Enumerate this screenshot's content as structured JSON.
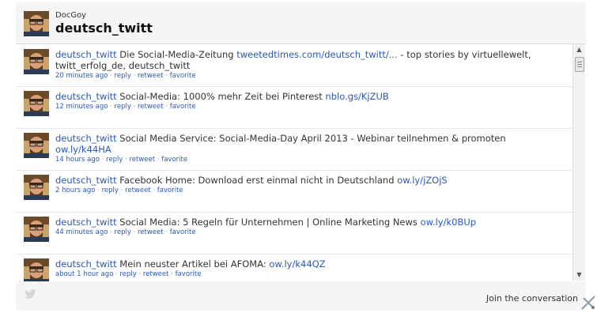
{
  "header": {
    "subline": "DocGoy",
    "title": "deutsch_twitt",
    "avatar_icon": "profile-avatar"
  },
  "tweets": [
    {
      "user": "deutsch_twitt",
      "text": " Die Social-Media-Zeitung ",
      "link": "tweetedtimes.com/deutsch_twitt/...",
      "text2": " - top stories by virtuellewelt, twitt_erfolg_de, deutsch_twitt",
      "time": "20 minutes ago",
      "actions": [
        "reply",
        "retweet",
        "favorite"
      ]
    },
    {
      "user": "deutsch_twitt",
      "text": " Social-Media: 1000% mehr Zeit bei Pinterest ",
      "link": "nblo.gs/KjZUB",
      "text2": "",
      "time": "12 minutes ago",
      "actions": [
        "reply",
        "retweet",
        "favorite"
      ]
    },
    {
      "user": "deutsch_twitt",
      "text": " Social Media Service: Social-Media-Day April 2013 - Webinar teilnehmen & promoten ",
      "link": "ow.ly/k44HA",
      "text2": "",
      "time": "14 hours ago",
      "actions": [
        "reply",
        "retweet",
        "favorite"
      ]
    },
    {
      "user": "deutsch_twitt",
      "text": " Facebook Home: Download erst einmal nicht in Deutschland ",
      "link": "ow.ly/jZOjS",
      "text2": "",
      "time": "2 hours ago",
      "actions": [
        "reply",
        "retweet",
        "favorite"
      ]
    },
    {
      "user": "deutsch_twitt",
      "text": " Social Media: 5 Regeln für Unternehmen | Online Marketing News ",
      "link": "ow.ly/k0BUp",
      "text2": "",
      "time": "44 minutes ago",
      "actions": [
        "reply",
        "retweet",
        "favorite"
      ]
    },
    {
      "user": "deutsch_twitt",
      "text": " Mein neuster Artikel bei AFOMA: ",
      "link": "ow.ly/k44QZ",
      "text2": "",
      "time": "about 1 hour ago",
      "actions": [
        "reply",
        "retweet",
        "favorite"
      ]
    }
  ],
  "footer": {
    "join_label": "Join the conversation",
    "bird_icon": "twitter-bird-icon",
    "resize_icon": "resize-tool-icon"
  },
  "colors": {
    "link": "#2b58b6",
    "text": "#333333",
    "widget_bg": "#f5f5f5"
  }
}
